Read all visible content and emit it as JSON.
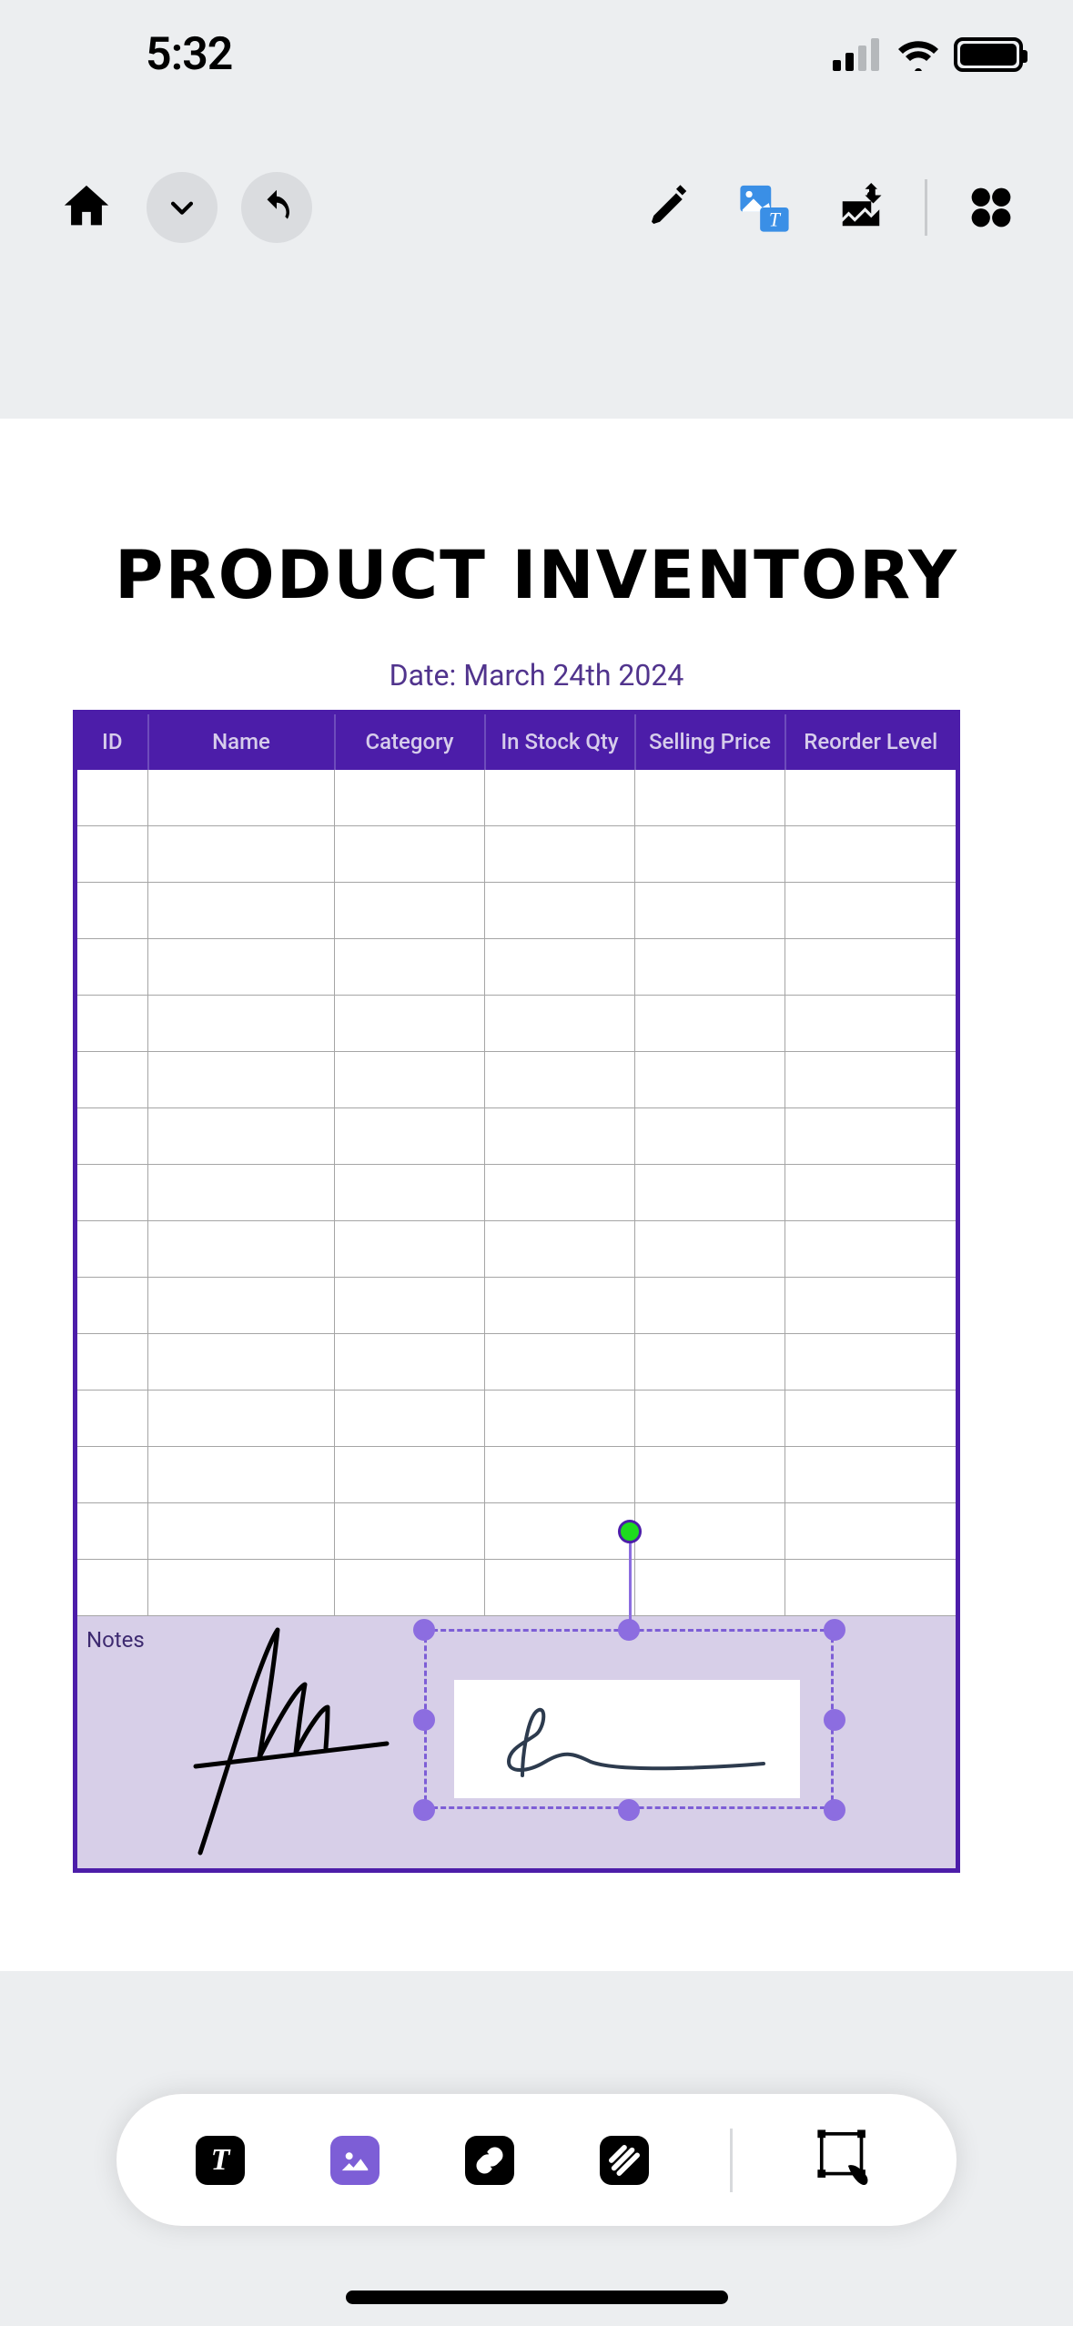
{
  "status": {
    "time": "5:32"
  },
  "toolbar": {
    "home": "home-icon",
    "dropdown": "chevron-down-icon",
    "undo": "undo-icon",
    "mark": "highlighter-icon",
    "text_image": "textimage-icon",
    "insert": "insert-image-icon",
    "apps": "apps-icon"
  },
  "document": {
    "title": "PRODUCT INVENTORY",
    "date_label": "Date: March 24th 2024",
    "columns": [
      "ID",
      "Name",
      "Category",
      "In Stock Qty",
      "Selling Price",
      "Reorder Level"
    ],
    "notes_label": "Notes"
  },
  "bottom": {
    "text": "T",
    "image": "image-icon",
    "link": "link-icon",
    "texture": "texture-icon",
    "transform": "transform-icon"
  }
}
